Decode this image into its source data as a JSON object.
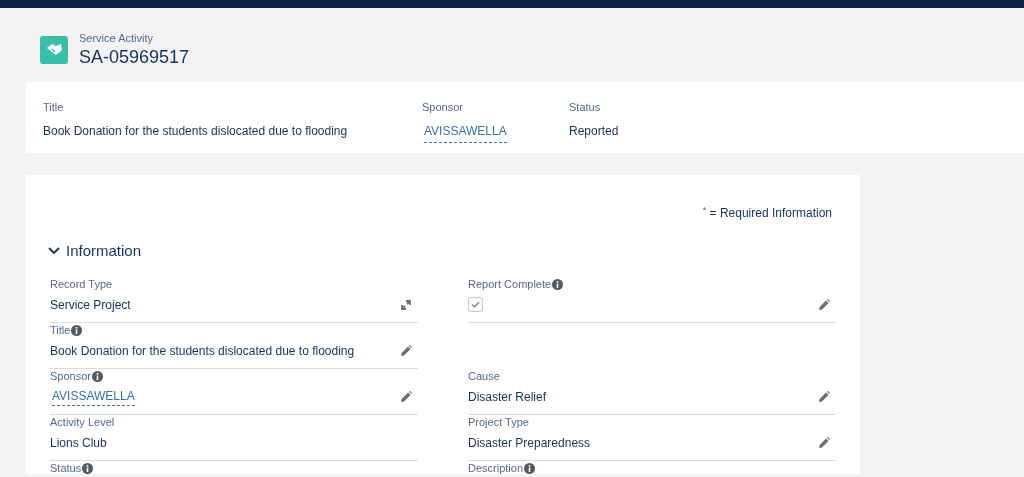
{
  "header": {
    "object_type": "Service Activity",
    "record_name": "SA-05969517"
  },
  "highlights": [
    {
      "label": "Title",
      "value": "Book Donation for the students dislocated due to flooding",
      "kind": "text"
    },
    {
      "label": "Sponsor",
      "value": "AVISSAWELLA",
      "kind": "link"
    },
    {
      "label": "Status",
      "value": "Reported",
      "kind": "text"
    }
  ],
  "required_note": {
    "mark": "*",
    "text": "= Required Information"
  },
  "section": {
    "title": "Information",
    "expanded": true
  },
  "rows": [
    {
      "left": {
        "label": "Record Type",
        "info": false,
        "kind": "text",
        "value": "Service Project",
        "editable": false,
        "type_changeable": true
      },
      "right": {
        "label": "Report Complete",
        "info": true,
        "kind": "checkbox",
        "checked": true,
        "editable": true
      }
    },
    {
      "left": {
        "label": "Title",
        "info": true,
        "kind": "text",
        "value": "Book Donation for the students dislocated due to flooding",
        "editable": true
      },
      "right": null
    },
    {
      "left": {
        "label": "Sponsor",
        "info": true,
        "kind": "link",
        "value": "AVISSAWELLA",
        "editable": true
      },
      "right": {
        "label": "Cause",
        "info": false,
        "kind": "text",
        "value": "Disaster Relief",
        "editable": true
      }
    },
    {
      "left": {
        "label": "Activity Level",
        "info": false,
        "kind": "text",
        "value": "Lions Club",
        "editable": false
      },
      "right": {
        "label": "Project Type",
        "info": false,
        "kind": "text",
        "value": "Disaster Preparedness",
        "editable": true
      }
    },
    {
      "left": {
        "label": "Status",
        "info": true,
        "kind": "label_only"
      },
      "right": {
        "label": "Description",
        "info": true,
        "kind": "label_only"
      }
    }
  ]
}
